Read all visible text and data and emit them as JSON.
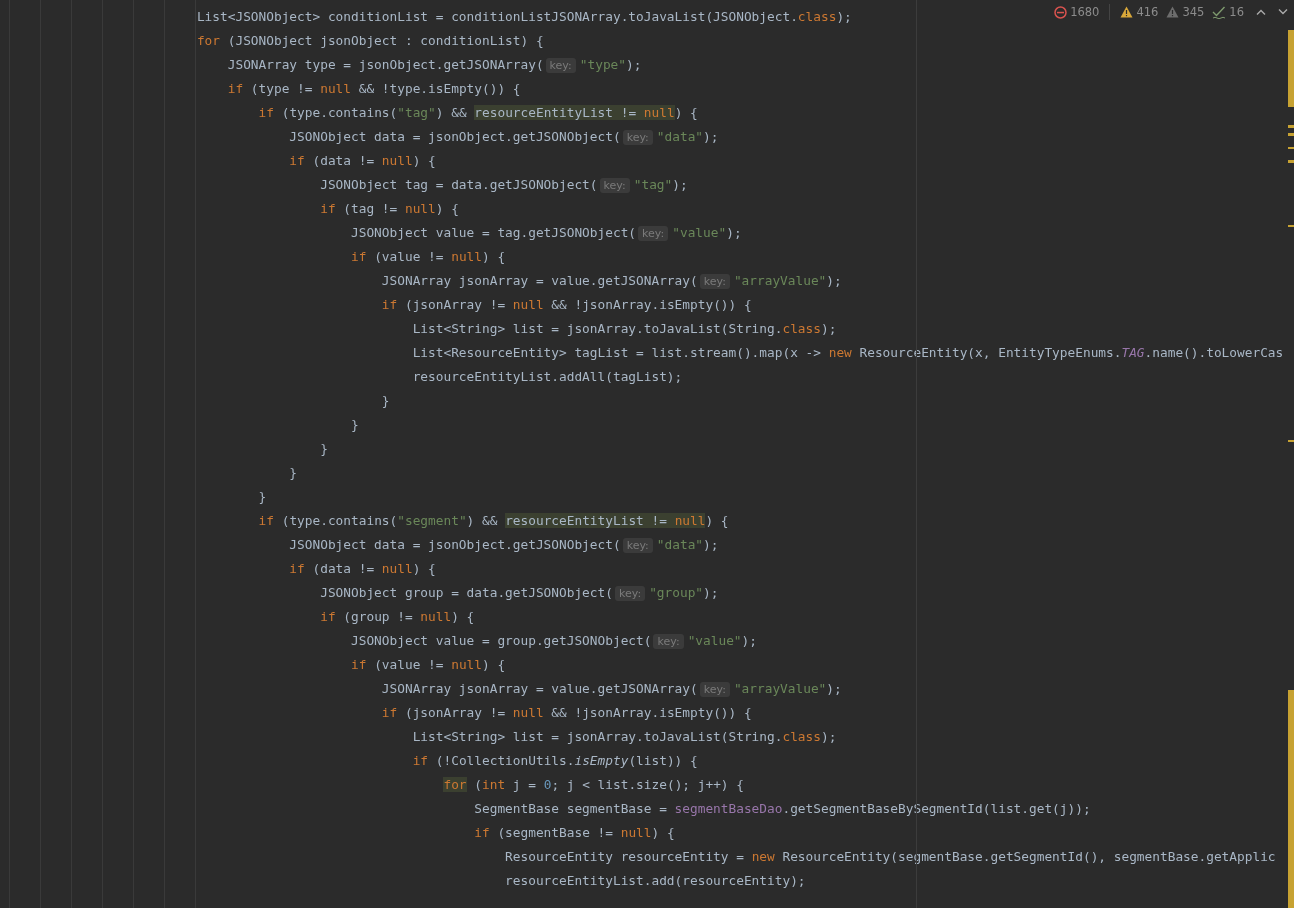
{
  "inspections": [
    {
      "kind": "error",
      "count": "1680"
    },
    {
      "kind": "warning",
      "count": "416"
    },
    {
      "kind": "weak_warning",
      "count": "345"
    },
    {
      "kind": "typo",
      "count": "16"
    }
  ],
  "code_lines": [
    {
      "tokens": [
        {
          "kind": "plain",
          "text": "                        List<JSONObject> conditionList = conditionListJSONArray.toJavaList(JSONObject."
        },
        {
          "kind": "keyword",
          "text": "class"
        },
        {
          "kind": "plain",
          "text": ");"
        }
      ]
    },
    {
      "tokens": [
        {
          "kind": "keyword",
          "text": "                        for"
        },
        {
          "kind": "plain",
          "text": " (JSONObject jsonObject : conditionList) {"
        }
      ]
    },
    {
      "tokens": [
        {
          "kind": "plain",
          "text": "                            JSONArray type = jsonObject.getJSONArray("
        },
        {
          "kind": "hint",
          "text": "key:"
        },
        {
          "kind": "string",
          "text": "\"type\""
        },
        {
          "kind": "plain",
          "text": ");"
        }
      ]
    },
    {
      "tokens": [
        {
          "kind": "keyword",
          "text": "                            if"
        },
        {
          "kind": "plain",
          "text": " (type != "
        },
        {
          "kind": "keyword",
          "text": "null"
        },
        {
          "kind": "plain",
          "text": " && !type.isEmpty()) {"
        }
      ]
    },
    {
      "tokens": [
        {
          "kind": "keyword",
          "text": "                                if"
        },
        {
          "kind": "plain",
          "text": " (type.contains("
        },
        {
          "kind": "string",
          "text": "\"tag\""
        },
        {
          "kind": "plain",
          "text": ") && "
        },
        {
          "kind": "match",
          "text": "resourceEntityList != "
        },
        {
          "kind": "match_keyword",
          "text": "null"
        },
        {
          "kind": "plain",
          "text": ") {"
        }
      ]
    },
    {
      "tokens": [
        {
          "kind": "plain",
          "text": "                                    JSONObject data = jsonObject.getJSONObject("
        },
        {
          "kind": "hint",
          "text": "key:"
        },
        {
          "kind": "string",
          "text": "\"data\""
        },
        {
          "kind": "plain",
          "text": ");"
        }
      ]
    },
    {
      "tokens": [
        {
          "kind": "keyword",
          "text": "                                    if"
        },
        {
          "kind": "plain",
          "text": " (data != "
        },
        {
          "kind": "keyword",
          "text": "null"
        },
        {
          "kind": "plain",
          "text": ") {"
        }
      ]
    },
    {
      "tokens": [
        {
          "kind": "plain",
          "text": "                                        JSONObject tag = data.getJSONObject("
        },
        {
          "kind": "hint",
          "text": "key:"
        },
        {
          "kind": "string",
          "text": "\"tag\""
        },
        {
          "kind": "plain",
          "text": ");"
        }
      ]
    },
    {
      "tokens": [
        {
          "kind": "keyword",
          "text": "                                        if"
        },
        {
          "kind": "plain",
          "text": " (tag != "
        },
        {
          "kind": "keyword",
          "text": "null"
        },
        {
          "kind": "plain",
          "text": ") {"
        }
      ]
    },
    {
      "tokens": [
        {
          "kind": "plain",
          "text": "                                            JSONObject value = tag.getJSONObject("
        },
        {
          "kind": "hint",
          "text": "key:"
        },
        {
          "kind": "string",
          "text": "\"value\""
        },
        {
          "kind": "plain",
          "text": ");"
        }
      ]
    },
    {
      "tokens": [
        {
          "kind": "keyword",
          "text": "                                            if"
        },
        {
          "kind": "plain",
          "text": " (value != "
        },
        {
          "kind": "keyword",
          "text": "null"
        },
        {
          "kind": "plain",
          "text": ") {"
        }
      ]
    },
    {
      "tokens": [
        {
          "kind": "plain",
          "text": "                                                JSONArray jsonArray = value.getJSONArray("
        },
        {
          "kind": "hint",
          "text": "key:"
        },
        {
          "kind": "string",
          "text": "\"arrayValue\""
        },
        {
          "kind": "plain",
          "text": ");"
        }
      ]
    },
    {
      "tokens": [
        {
          "kind": "keyword",
          "text": "                                                if"
        },
        {
          "kind": "plain",
          "text": " (jsonArray != "
        },
        {
          "kind": "keyword",
          "text": "null"
        },
        {
          "kind": "plain",
          "text": " && !jsonArray.isEmpty()) {"
        }
      ]
    },
    {
      "tokens": [
        {
          "kind": "plain",
          "text": "                                                    List<String> list = jsonArray.toJavaList(String."
        },
        {
          "kind": "keyword",
          "text": "class"
        },
        {
          "kind": "plain",
          "text": ");"
        }
      ]
    },
    {
      "tokens": [
        {
          "kind": "plain",
          "text": "                                                    List<ResourceEntity> tagList = list.stream().map(x -> "
        },
        {
          "kind": "keyword",
          "text": "new"
        },
        {
          "kind": "plain",
          "text": " ResourceEntity(x, EntityTypeEnums."
        },
        {
          "kind": "static_field",
          "text": "TAG"
        },
        {
          "kind": "plain",
          "text": ".name().toLowerCas"
        }
      ]
    },
    {
      "tokens": [
        {
          "kind": "plain",
          "text": "                                                    resourceEntityList.addAll(tagList);"
        }
      ]
    },
    {
      "tokens": [
        {
          "kind": "plain",
          "text": "                                                }"
        }
      ]
    },
    {
      "tokens": [
        {
          "kind": "plain",
          "text": "                                            }"
        }
      ]
    },
    {
      "tokens": [
        {
          "kind": "plain",
          "text": "                                        }"
        }
      ]
    },
    {
      "tokens": [
        {
          "kind": "plain",
          "text": "                                    }"
        }
      ]
    },
    {
      "tokens": [
        {
          "kind": "plain",
          "text": "                                }"
        }
      ]
    },
    {
      "tokens": [
        {
          "kind": "keyword",
          "text": "                                if"
        },
        {
          "kind": "plain",
          "text": " (type.contains("
        },
        {
          "kind": "string",
          "text": "\"segment\""
        },
        {
          "kind": "plain",
          "text": ") && "
        },
        {
          "kind": "match",
          "text": "resourceEntityList != "
        },
        {
          "kind": "match_keyword",
          "text": "null"
        },
        {
          "kind": "plain",
          "text": ") {"
        }
      ]
    },
    {
      "tokens": [
        {
          "kind": "plain",
          "text": "                                    JSONObject data = jsonObject.getJSONObject("
        },
        {
          "kind": "hint",
          "text": "key:"
        },
        {
          "kind": "string",
          "text": "\"data\""
        },
        {
          "kind": "plain",
          "text": ");"
        }
      ]
    },
    {
      "tokens": [
        {
          "kind": "keyword",
          "text": "                                    if"
        },
        {
          "kind": "plain",
          "text": " (data != "
        },
        {
          "kind": "keyword",
          "text": "null"
        },
        {
          "kind": "plain",
          "text": ") {"
        }
      ]
    },
    {
      "tokens": [
        {
          "kind": "plain",
          "text": "                                        JSONObject group = data.getJSONObject("
        },
        {
          "kind": "hint",
          "text": "key:"
        },
        {
          "kind": "string",
          "text": "\"group\""
        },
        {
          "kind": "plain",
          "text": ");"
        }
      ]
    },
    {
      "tokens": [
        {
          "kind": "keyword",
          "text": "                                        if"
        },
        {
          "kind": "plain",
          "text": " (group != "
        },
        {
          "kind": "keyword",
          "text": "null"
        },
        {
          "kind": "plain",
          "text": ") {"
        }
      ]
    },
    {
      "tokens": [
        {
          "kind": "plain",
          "text": "                                            JSONObject value = group.getJSONObject("
        },
        {
          "kind": "hint",
          "text": "key:"
        },
        {
          "kind": "string",
          "text": "\"value\""
        },
        {
          "kind": "plain",
          "text": ");"
        }
      ]
    },
    {
      "tokens": [
        {
          "kind": "keyword",
          "text": "                                            if"
        },
        {
          "kind": "plain",
          "text": " (value != "
        },
        {
          "kind": "keyword",
          "text": "null"
        },
        {
          "kind": "plain",
          "text": ") {"
        }
      ]
    },
    {
      "tokens": [
        {
          "kind": "plain",
          "text": "                                                JSONArray jsonArray = value.getJSONArray("
        },
        {
          "kind": "hint",
          "text": "key:"
        },
        {
          "kind": "string",
          "text": "\"arrayValue\""
        },
        {
          "kind": "plain",
          "text": ");"
        }
      ]
    },
    {
      "tokens": [
        {
          "kind": "keyword",
          "text": "                                                if"
        },
        {
          "kind": "plain",
          "text": " (jsonArray != "
        },
        {
          "kind": "keyword",
          "text": "null"
        },
        {
          "kind": "plain",
          "text": " && !jsonArray.isEmpty()) {"
        }
      ]
    },
    {
      "tokens": [
        {
          "kind": "plain",
          "text": "                                                    List<String> list = jsonArray.toJavaList(String."
        },
        {
          "kind": "keyword",
          "text": "class"
        },
        {
          "kind": "plain",
          "text": ");"
        }
      ]
    },
    {
      "tokens": [
        {
          "kind": "keyword",
          "text": "                                                    if"
        },
        {
          "kind": "plain",
          "text": " (!CollectionUtils."
        },
        {
          "kind": "static_method",
          "text": "isEmpty"
        },
        {
          "kind": "plain",
          "text": "(list)) {"
        }
      ]
    },
    {
      "tokens": [
        {
          "kind": "match_keyword",
          "text": "                                                        for"
        },
        {
          "kind": "plain",
          "text": " ("
        },
        {
          "kind": "keyword",
          "text": "int"
        },
        {
          "kind": "plain",
          "text": " j = "
        },
        {
          "kind": "number",
          "text": "0"
        },
        {
          "kind": "plain",
          "text": "; j < list.size(); j++) {"
        }
      ]
    },
    {
      "tokens": [
        {
          "kind": "plain",
          "text": "                                                            SegmentBase segmentBase = "
        },
        {
          "kind": "field",
          "text": "segmentBaseDao"
        },
        {
          "kind": "plain",
          "text": ".getSegmentBaseBySegmentId(list.get(j));"
        }
      ]
    },
    {
      "tokens": [
        {
          "kind": "keyword",
          "text": "                                                            if"
        },
        {
          "kind": "plain",
          "text": " (segmentBase != "
        },
        {
          "kind": "keyword",
          "text": "null"
        },
        {
          "kind": "plain",
          "text": ") {"
        }
      ]
    },
    {
      "tokens": [
        {
          "kind": "plain",
          "text": "                                                                ResourceEntity resourceEntity = "
        },
        {
          "kind": "keyword",
          "text": "new"
        },
        {
          "kind": "plain",
          "text": " ResourceEntity(segmentBase.getSegmentId(), segmentBase.getApplic"
        }
      ]
    },
    {
      "tokens": [
        {
          "kind": "plain",
          "text": "                                                                resourceEntityList.add(resourceEntity);"
        }
      ]
    }
  ]
}
